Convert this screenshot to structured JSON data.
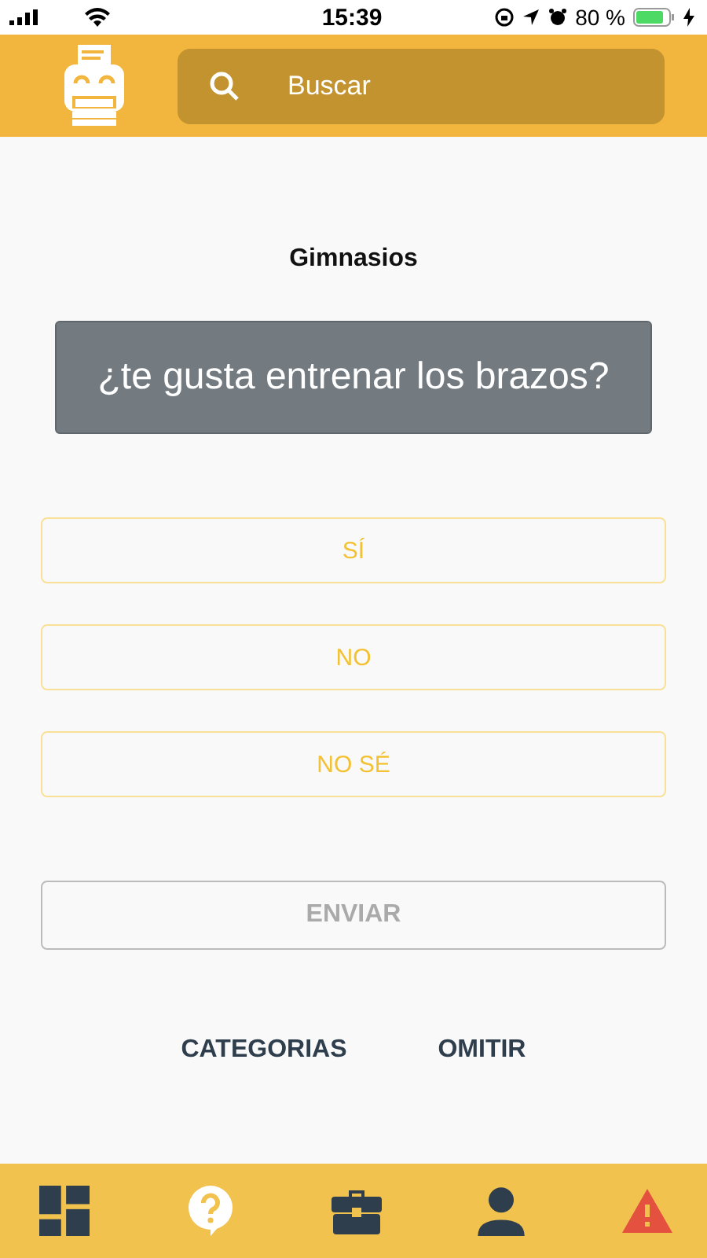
{
  "status_bar": {
    "time": "15:39",
    "battery": "80 %"
  },
  "header": {
    "search": {
      "placeholder": "Buscar"
    }
  },
  "category": "Gimnasios",
  "question": "¿te gusta entrenar los brazos?",
  "answers": [
    {
      "label": "SÍ",
      "selected": false
    },
    {
      "label": "NO",
      "selected": false
    },
    {
      "label": "NO SÉ",
      "selected": false
    }
  ],
  "submit": {
    "label": "ENVIAR",
    "disabled": true
  },
  "links": [
    "CATEGORIAS",
    "OMITIR"
  ],
  "nav": [
    {
      "kind": "dashboard"
    },
    {
      "kind": "help"
    },
    {
      "kind": "briefcase"
    },
    {
      "kind": "person"
    },
    {
      "kind": "warning"
    }
  ]
}
